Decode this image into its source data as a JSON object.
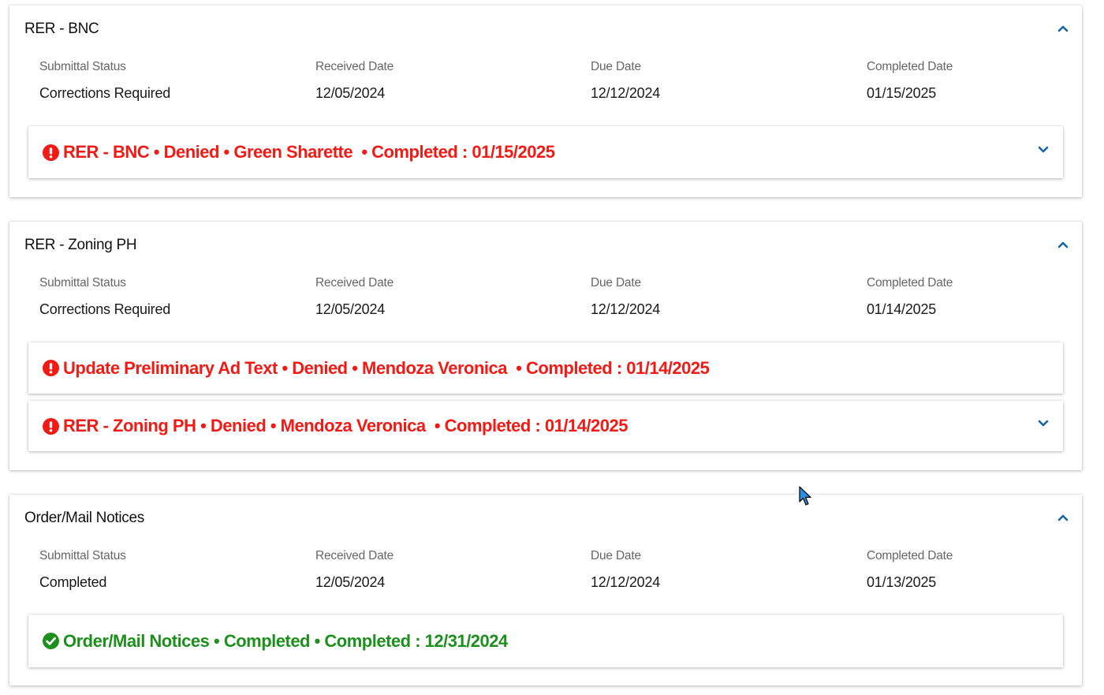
{
  "colors": {
    "denied": "#f11a14",
    "completed": "#1d8f1d",
    "chevron": "#1565a6"
  },
  "labels": {
    "submittal_status": "Submittal Status",
    "received_date": "Received Date",
    "due_date": "Due Date",
    "completed_date": "Completed Date"
  },
  "panels": [
    {
      "title": "RER - BNC",
      "submittal_status": "Corrections Required",
      "received_date": "12/05/2024",
      "due_date": "12/12/2024",
      "completed_date": "01/15/2025",
      "tasks": [
        {
          "text": "RER - BNC • Denied • Green Sharette  • Completed : 01/15/2025",
          "status": "denied",
          "icon": "exclamation-circle-icon",
          "expandable": true
        }
      ]
    },
    {
      "title": "RER - Zoning PH",
      "submittal_status": "Corrections Required",
      "received_date": "12/05/2024",
      "due_date": "12/12/2024",
      "completed_date": "01/14/2025",
      "tasks": [
        {
          "text": "Update Preliminary Ad Text • Denied • Mendoza Veronica  • Completed : 01/14/2025",
          "status": "denied",
          "icon": "exclamation-circle-icon",
          "expandable": false
        },
        {
          "text": "RER - Zoning PH • Denied • Mendoza Veronica  • Completed : 01/14/2025",
          "status": "denied",
          "icon": "exclamation-circle-icon",
          "expandable": true
        }
      ]
    },
    {
      "title": "Order/Mail Notices",
      "submittal_status": "Completed",
      "received_date": "12/05/2024",
      "due_date": "12/12/2024",
      "completed_date": "01/13/2025",
      "tasks": [
        {
          "text": "Order/Mail Notices • Completed • Completed : 12/31/2024",
          "status": "completed",
          "icon": "check-circle-icon",
          "expandable": false
        }
      ]
    }
  ]
}
